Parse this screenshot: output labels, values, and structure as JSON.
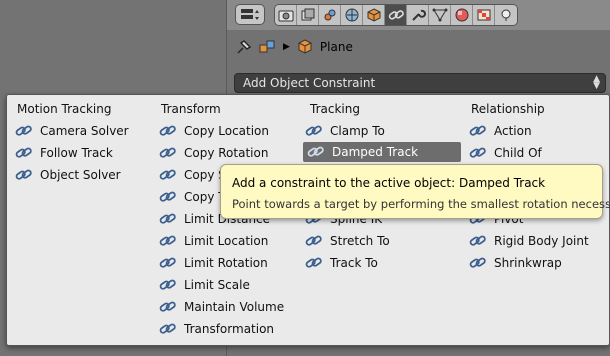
{
  "properties": {
    "path": {
      "object_name": "Plane"
    },
    "add_constraint_label": "Add Object Constraint"
  },
  "menu": {
    "columns": [
      {
        "title": "Motion Tracking",
        "items": [
          "Camera Solver",
          "Follow Track",
          "Object Solver"
        ]
      },
      {
        "title": "Transform",
        "items": [
          "Copy Location",
          "Copy Rotation",
          "Copy S",
          "Copy T",
          "Limit Distance",
          "Limit Location",
          "Limit Rotation",
          "Limit Scale",
          "Maintain Volume",
          "Transformation"
        ]
      },
      {
        "title": "Tracking",
        "items": [
          "Clamp To",
          "Damped Track",
          "",
          "",
          "Spline IK",
          "Stretch To",
          "Track To"
        ]
      },
      {
        "title": "Relationship",
        "items": [
          "Action",
          "Child Of",
          "",
          "",
          "Pivot",
          "Rigid Body Joint",
          "Shrinkwrap"
        ]
      }
    ],
    "highlighted_item": "Damped Track"
  },
  "tooltip": {
    "title_prefix": "Add a constraint to the active object:",
    "title_value": "Damped Track",
    "description": "Point towards a target by performing the smallest rotation necessary"
  },
  "colors": {
    "menu_bg": "#eaeaea",
    "highlight": "#6d6d6d",
    "tooltip_bg": "#fff9c2",
    "dark_button": "#3f3f3f"
  },
  "icons": {
    "constraint": "chain-link-icon",
    "pin": "pin-icon",
    "object": "cube-icon",
    "wrench": "wrench-icon"
  }
}
